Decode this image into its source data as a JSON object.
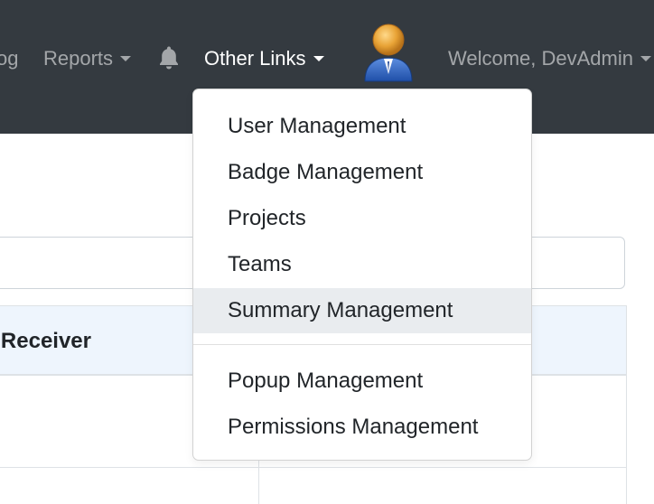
{
  "navbar": {
    "blog_partial": "og",
    "reports": "Reports",
    "other_links": "Other Links",
    "welcome": "Welcome, DevAdmin"
  },
  "table": {
    "header_partial": "ry Receiver"
  },
  "dropdown": {
    "items": [
      {
        "label": "User Management"
      },
      {
        "label": "Badge Management"
      },
      {
        "label": "Projects"
      },
      {
        "label": "Teams"
      },
      {
        "label": "Summary Management"
      },
      {
        "label": "Popup Management"
      },
      {
        "label": "Permissions Management"
      }
    ],
    "highlighted": "Summary Management"
  },
  "icons": {
    "bell": "bell-icon",
    "avatar": "user-avatar-icon",
    "caret": "caret-down-icon"
  },
  "colors": {
    "navbar_bg": "#343a40",
    "hover_bg": "#e9ecef",
    "table_header_bg": "#eef5fd",
    "success": "#198754",
    "danger": "#dc3545"
  }
}
